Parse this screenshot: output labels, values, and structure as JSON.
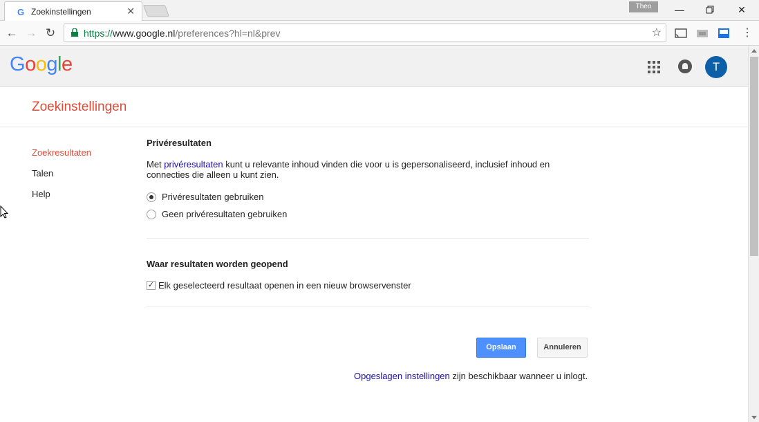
{
  "browser": {
    "tab_title": "Zoekinstellingen",
    "favicon_letter": "G",
    "user_badge": "Theo",
    "url_scheme": "https://",
    "url_host": "www.google.nl",
    "url_path": "/preferences?hl=nl&prev",
    "icons": {
      "back": "back-arrow-icon",
      "forward": "forward-arrow-icon",
      "reload": "reload-icon",
      "lock": "lock-icon",
      "star": "bookmark-star-icon",
      "cast": "cast-icon",
      "menu": "kebab-menu-icon"
    }
  },
  "google_header": {
    "logo_letters": [
      "G",
      "o",
      "o",
      "g",
      "l",
      "e"
    ],
    "logo_colors": [
      "#4285f4",
      "#ea4335",
      "#fbbc05",
      "#4285f4",
      "#34a853",
      "#ea4335"
    ],
    "avatar_letter": "T",
    "avatar_color": "#0d5fa8"
  },
  "page": {
    "title": "Zoekinstellingen",
    "accent_color": "#dd4b39"
  },
  "sidebar": {
    "items": [
      {
        "label": "Zoekresultaten",
        "active": true
      },
      {
        "label": "Talen",
        "active": false
      },
      {
        "label": "Help",
        "active": false
      }
    ]
  },
  "private_results": {
    "title": "Privéresultaten",
    "desc_prefix": "Met ",
    "desc_link": "privéresultaten",
    "desc_suffix": " kunt u relevante inhoud vinden die voor u is gepersonaliseerd, inclusief inhoud en connecties die alleen u kunt zien.",
    "options": [
      {
        "label": "Privéresultaten gebruiken",
        "selected": true
      },
      {
        "label": "Geen privéresultaten gebruiken",
        "selected": false
      }
    ]
  },
  "open_results": {
    "title": "Waar resultaten worden geopend",
    "checkbox_label": "Elk geselecteerd resultaat openen in een nieuw browservenster",
    "checked": true
  },
  "actions": {
    "save_label": "Opslaan",
    "cancel_label": "Annuleren"
  },
  "footer": {
    "link": "Opgeslagen instellingen",
    "suffix": " zijn beschikbaar wanneer u inlogt."
  }
}
